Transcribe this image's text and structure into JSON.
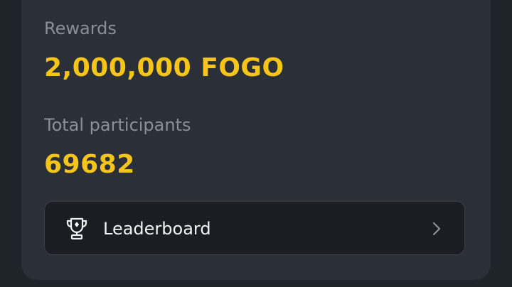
{
  "rewards": {
    "label": "Rewards",
    "value": "2,000,000 FOGO"
  },
  "participants": {
    "label": "Total participants",
    "value": "69682"
  },
  "leaderboard": {
    "label": "Leaderboard",
    "icon": "trophy-icon",
    "chevron": "chevron-right-icon"
  },
  "colors": {
    "accent": "#f5c518",
    "card": "#2a2f38",
    "background": "#1f232a",
    "button": "#1b1d22"
  }
}
